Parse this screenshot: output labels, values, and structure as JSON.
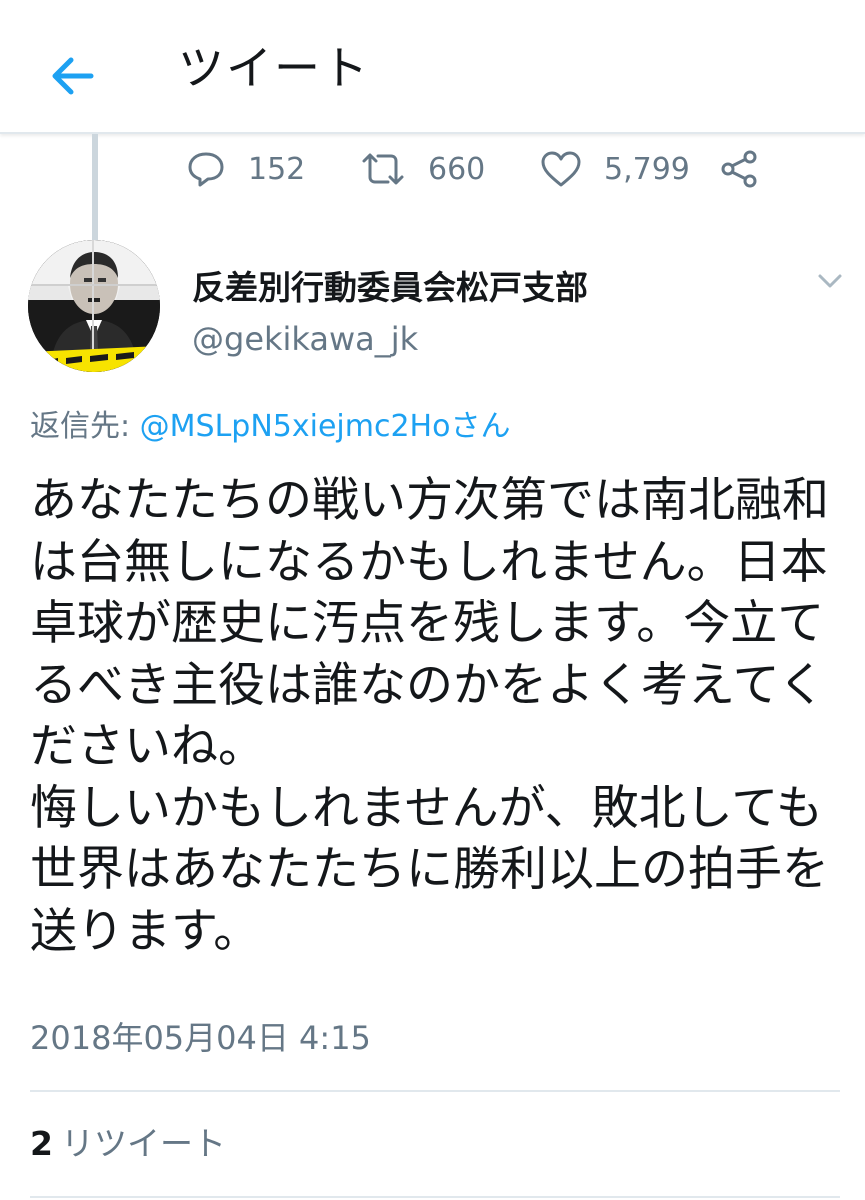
{
  "header": {
    "title": "ツイート",
    "back_icon": "back-arrow-icon",
    "accent_color": "#1da1f2"
  },
  "parent_actions": {
    "reply_count": "152",
    "retweet_count": "660",
    "like_count": "5,799"
  },
  "tweet": {
    "display_name": "反差別行動委員会松戸支部",
    "handle": "@gekikawa_jk",
    "reply_to_label": "返信先: ",
    "reply_to_mention": "@MSLpN5xiejmc2Hoさん",
    "text": "あなたたちの戦い方次第では南北融和は台無しになるかもしれません。日本卓球が歴史に汚点を残します。今立てるべき主役は誰なのかをよく考えてくださいね。\n悔しいかもしれませんが、敗北しても世界はあなたたちに勝利以上の拍手を送ります。",
    "timestamp": "2018年05月04日 4:15"
  },
  "stats": {
    "retweets_count": "2",
    "retweets_label": "リツイート"
  },
  "colors": {
    "text_primary": "#14171a",
    "text_secondary": "#657786",
    "link": "#1da1f2",
    "divider": "#e1e8ed"
  }
}
